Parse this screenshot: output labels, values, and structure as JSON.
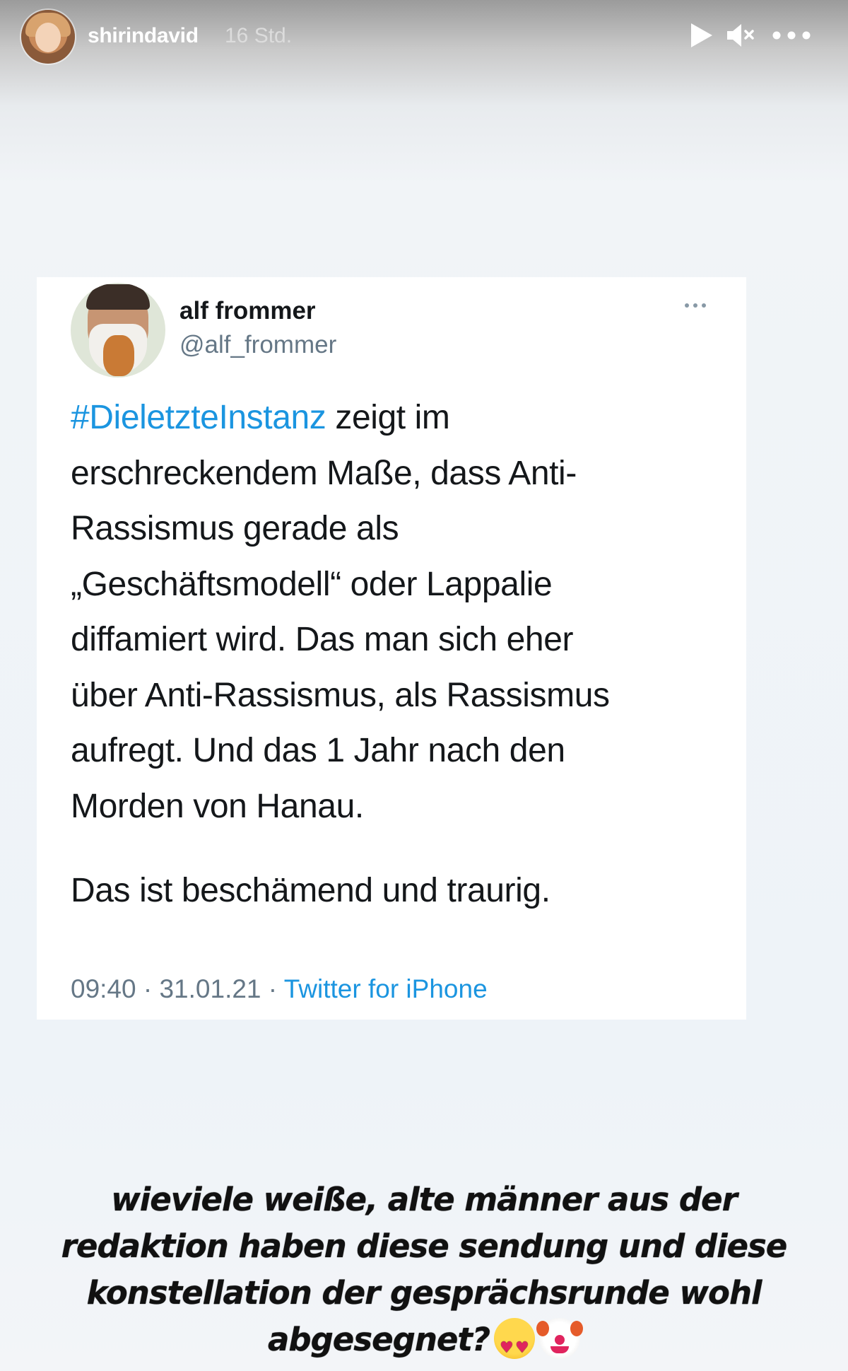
{
  "story": {
    "username": "shirindavid",
    "time_ago": "16 Std."
  },
  "tweet": {
    "display_name": "alf frommer",
    "handle": "@alf_frommer",
    "hashtag": "#DieletzteInstanz",
    "lines": [
      " zeigt im",
      "erschreckendem Maße, dass Anti-",
      "Rassismus gerade als",
      "„Geschäftsmodell“ oder Lappalie",
      "diffamiert wird. Das man sich eher",
      "über Anti-Rassismus, als Rassismus",
      "aufregt. Und das 1 Jahr nach den",
      "Morden von Hanau."
    ],
    "second_paragraph": "Das ist beschämend und traurig.",
    "time": "09:40",
    "date": "31.01.21",
    "separator": " · ",
    "source": "Twitter for iPhone"
  },
  "caption": {
    "lines": [
      "wieviele weiße, alte männer aus der",
      "redaktion haben diese sendung und diese",
      "konstellation der gesprächsrunde wohl",
      "abgesegnet?"
    ],
    "emojis": [
      "heart-eyes-emoji",
      "clown-emoji"
    ]
  },
  "colors": {
    "twitter_blue": "#1b95e0",
    "twitter_gray": "#657786",
    "text_dark": "#14171a"
  }
}
